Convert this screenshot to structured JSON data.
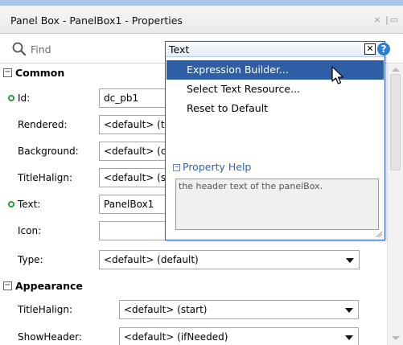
{
  "window": {
    "title": "Panel Box - PanelBox1 - Properties",
    "close_glyph": "×",
    "toolbar_glyph": "|",
    "collapse_glyph": "▭"
  },
  "search": {
    "placeholder": "Find"
  },
  "sections": {
    "common": {
      "label": "Common",
      "rows": {
        "id": {
          "label": "Id:",
          "value": "dc_pb1"
        },
        "rendered": {
          "label": "Rendered:",
          "value": "<default> (t"
        },
        "background": {
          "label": "Background:",
          "value": "<default> (c"
        },
        "titlehalign": {
          "label": "TitleHalign:",
          "value": "<default> (s"
        },
        "text": {
          "label": "Text:",
          "value": "PanelBox1"
        },
        "icon": {
          "label": "Icon:",
          "value": ""
        },
        "type": {
          "label": "Type:",
          "value": "<default> (default)"
        }
      }
    },
    "appearance": {
      "label": "Appearance",
      "rows": {
        "titlehalign": {
          "label": "TitleHalign:",
          "value": "<default> (start)"
        },
        "showheader": {
          "label": "ShowHeader:",
          "value": "<default> (ifNeeded)"
        }
      }
    }
  },
  "popup": {
    "title": "Text",
    "close_glyph": "✕",
    "help_glyph": "?",
    "menu": [
      {
        "label": "Expression Builder...",
        "active": true
      },
      {
        "label": "Select Text Resource...",
        "active": false
      },
      {
        "label": "Reset to Default",
        "active": false
      }
    ],
    "property_help": {
      "label": "Property Help",
      "text": "the header text of the panelBox."
    }
  },
  "colors": {
    "accent": "#2e5fa6",
    "required_dot": "#2a9a3a",
    "help_link": "#2d5fb5"
  },
  "icons": {
    "search": "magnifier",
    "required": "green-circle",
    "cursor": "arrow-pointer"
  }
}
